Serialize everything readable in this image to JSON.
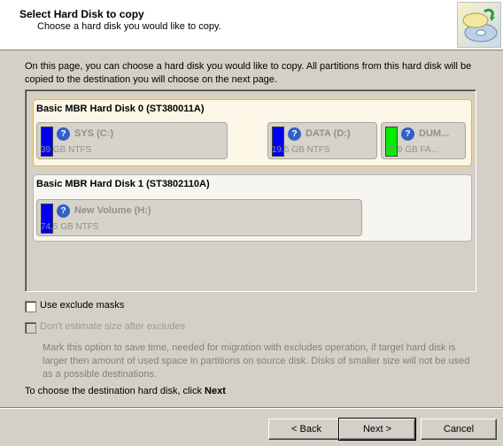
{
  "header": {
    "title": "Select Hard Disk to copy",
    "subtitle": "Choose a hard disk you would like to copy.",
    "icon": "disk-copy-wizard-icon"
  },
  "intro": "On this page, you can choose a hard disk you would like to copy. All partitions from this hard disk will be copied to the destination you will choose on the next page.",
  "disks": [
    {
      "title": "Basic MBR Hard Disk 0 (ST380011A)",
      "selected": true,
      "partitions": [
        {
          "name": "SYS (C:)",
          "size": "39 GB NTFS",
          "color": "#0000ee"
        },
        {
          "name": "DATA (D:)",
          "size": "19.5 GB NTFS",
          "color": "#0000ee"
        },
        {
          "name": "DUM...",
          "size": "15.9 GB FA...",
          "color": "#00ee00"
        }
      ]
    },
    {
      "title": "Basic MBR Hard Disk 1 (ST3802110A)",
      "selected": false,
      "partitions": [
        {
          "name": "New Volume (H:)",
          "size": "74.5 GB NTFS",
          "color": "#0000ee"
        }
      ]
    }
  ],
  "options": {
    "exclude_masks_label": "Use exclude masks",
    "dont_estimate_label": "Don't estimate size after excludes",
    "description": "Mark this option to save time, needed for migration with excludes operation, if target hard disk is larger then amount of used space in partitions on source disk. Disks of smaller size will not be used as a possible destinations."
  },
  "footer": {
    "hint_prefix": "To choose the destination hard disk, click",
    "hint_action": "Next"
  },
  "buttons": {
    "back": "< Back",
    "next": "Next >",
    "cancel": "Cancel"
  }
}
